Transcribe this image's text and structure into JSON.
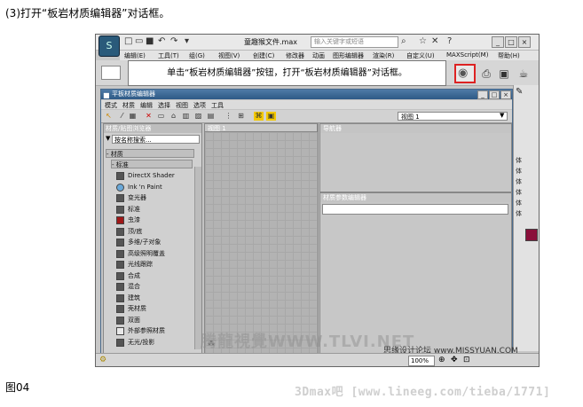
{
  "caption_top": "(3)打开“板岩材质编辑器”对话框。",
  "caption_bottom": "图04",
  "footer": "3Dmax吧  [www.lineeg.com/tieba/1771]",
  "app": {
    "title": "童趣猴文件.max",
    "search_placeholder": "输入关键字或短语",
    "menus": [
      "编辑(E)",
      "工具(T)",
      "组(G)",
      "视图(V)",
      "创建(C)",
      "修改器",
      "动画",
      "图形编辑器",
      "渲染(R)",
      "自定义(U)",
      "MAXScript(M)",
      "帮助(H)"
    ]
  },
  "tooltip": "单击“板岩材质编辑器”按钮，打开“板岩材质编辑器”对话框。",
  "slate": {
    "title": "平板材质编辑器",
    "menus": [
      "模式",
      "材质",
      "编辑",
      "选择",
      "视图",
      "选项",
      "工具"
    ],
    "view_select": "视图 1",
    "browser_title": "材质/贴图浏览器",
    "search_placeholder": "按名称搜索...",
    "cat_materials": "- 材质",
    "cat_standard": "- 标准",
    "materials": [
      {
        "name": "DirectX Shader",
        "color": "#555555"
      },
      {
        "name": "Ink 'n Paint",
        "color": "#6aa8d8"
      },
      {
        "name": "变光器",
        "color": "#555555"
      },
      {
        "name": "标准",
        "color": "#555555"
      },
      {
        "name": "虫漆",
        "color": "#a01818"
      },
      {
        "name": "顶/底",
        "color": "#555555"
      },
      {
        "name": "多维/子对象",
        "color": "#555555"
      },
      {
        "name": "高级照明覆盖",
        "color": "#555555"
      },
      {
        "name": "光线跟踪",
        "color": "#555555"
      },
      {
        "name": "合成",
        "color": "#555555"
      },
      {
        "name": "混合",
        "color": "#555555"
      },
      {
        "name": "建筑",
        "color": "#555555"
      },
      {
        "name": "壳材质",
        "color": "#555555"
      },
      {
        "name": "双面",
        "color": "#555555"
      },
      {
        "name": "外部参照材质",
        "color": "#e8e8e8"
      },
      {
        "name": "无光/投影",
        "color": "#555555"
      }
    ],
    "view_tab": "视图 1",
    "navigator_title": "导航器",
    "params_title": "材质参数编辑器"
  },
  "right_labels": [
    "体",
    "体",
    "体",
    "体",
    "体",
    "体"
  ],
  "status": {
    "zoom": "100%"
  },
  "watermark": "腾龍視覺WWW.TLVI.NET",
  "watermark2": "思缘设计论坛 www.MISSYUAN.COM"
}
